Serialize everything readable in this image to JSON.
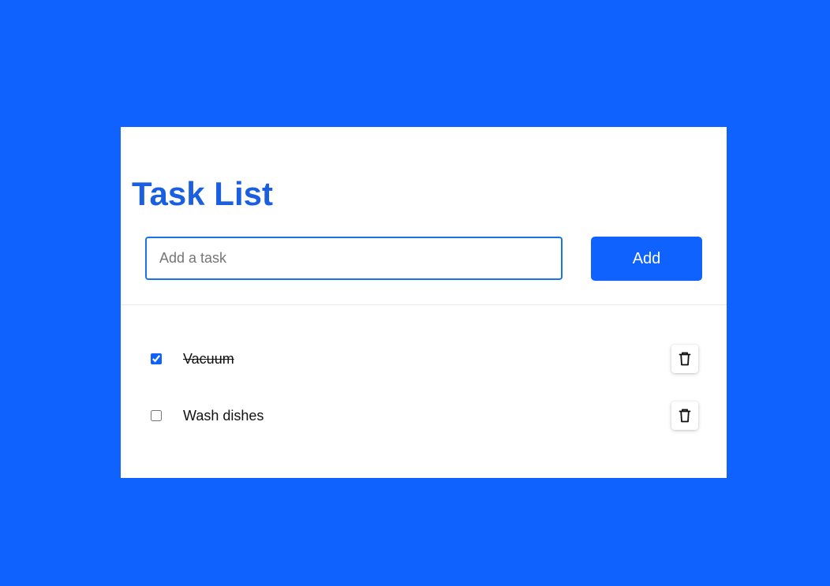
{
  "page": {
    "title": "Task List",
    "background_color": "#0f62fe",
    "accent_color": "#1a5fe0"
  },
  "form": {
    "input_value": "",
    "input_placeholder": "Add a task",
    "add_label": "Add"
  },
  "tasks": [
    {
      "label": "Vacuum",
      "completed": true,
      "delete_icon": "trash-icon"
    },
    {
      "label": "Wash dishes",
      "completed": false,
      "delete_icon": "trash-icon"
    }
  ]
}
